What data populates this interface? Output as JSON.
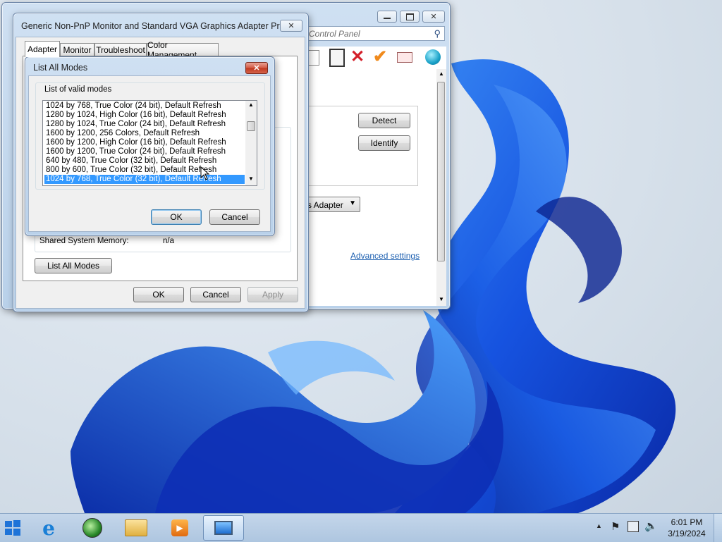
{
  "control_panel": {
    "search_placeholder": "Control Panel",
    "buttons": {
      "detect": "Detect",
      "identify": "Identify"
    },
    "adapter_dropdown": "s Adapter",
    "advanced_link": "Advanced settings"
  },
  "properties": {
    "title": "Generic Non-PnP Monitor and Standard VGA Graphics Adapter Pro...",
    "tabs": [
      "Adapter",
      "Monitor",
      "Troubleshoot",
      "Color Management"
    ],
    "shared_memory_label": "Shared System Memory:",
    "shared_memory_value": "n/a",
    "list_all_modes": "List All Modes",
    "ok": "OK",
    "cancel": "Cancel",
    "apply": "Apply"
  },
  "modes_dialog": {
    "title": "List All Modes",
    "group_label": "List of valid modes",
    "modes": [
      "1024 by 768, True Color (24 bit), Default Refresh",
      "1280 by 1024, High Color (16 bit), Default Refresh",
      "1280 by 1024, True Color (24 bit), Default Refresh",
      "1600 by 1200, 256 Colors, Default Refresh",
      "1600 by 1200, High Color (16 bit), Default Refresh",
      "1600 by 1200, True Color (24 bit), Default Refresh",
      "640 by 480, True Color (32 bit), Default Refresh",
      "800 by 600, True Color (32 bit), Default Refresh",
      "1024 by 768, True Color (32 bit), Default Refresh"
    ],
    "selected_index": 8,
    "ok": "OK",
    "cancel": "Cancel"
  },
  "taskbar": {
    "time": "6:01 PM",
    "date": "3/19/2024"
  },
  "colors": {
    "selection": "#3399ff",
    "link": "#1c5fb0",
    "wallpaper_blue": "#1646d8"
  }
}
